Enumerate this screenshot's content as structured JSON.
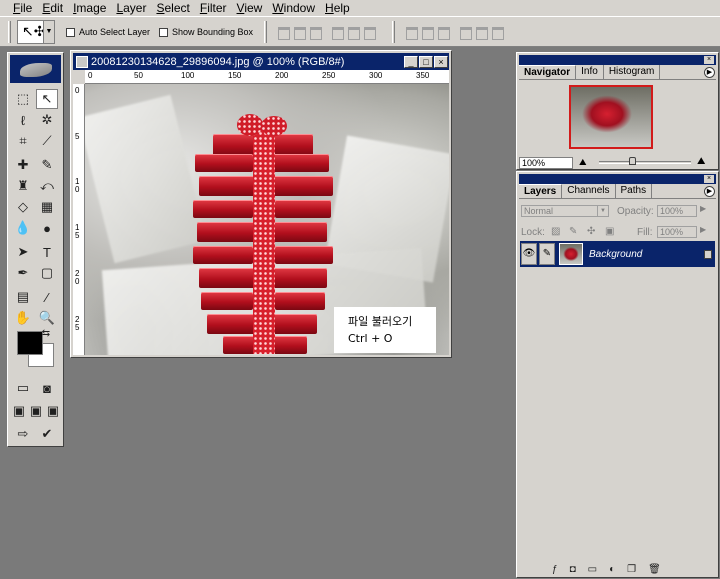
{
  "menu": [
    "File",
    "Edit",
    "Image",
    "Layer",
    "Select",
    "Filter",
    "View",
    "Window",
    "Help"
  ],
  "options": {
    "auto_select_label": "Auto Select Layer",
    "show_bounding_label": "Show Bounding Box"
  },
  "document": {
    "title": "20081230134628_29896094.jpg @ 100% (RGB/8#)",
    "ruler_top": [
      "0",
      "50",
      "100",
      "150",
      "200",
      "250",
      "300",
      "350"
    ],
    "ruler_left": [
      "0",
      "5",
      "1 0",
      "1 5",
      "2 0",
      "2 5"
    ],
    "note_line1": "파일 불러오기",
    "note_line2": "Ctrl + O"
  },
  "navigator": {
    "tabs": [
      "Navigator",
      "Info",
      "Histogram"
    ],
    "zoom": "100%"
  },
  "layers": {
    "tabs": [
      "Layers",
      "Channels",
      "Paths"
    ],
    "blend_mode": "Normal",
    "opacity_label": "Opacity:",
    "opacity_value": "100%",
    "lock_label": "Lock:",
    "fill_label": "Fill:",
    "fill_value": "100%",
    "layer_name": "Background"
  },
  "colors": {
    "title_bar": "#0a246a",
    "chrome": "#d6d3ce",
    "workspace": "#7a7a7a",
    "gift": "#c8141f"
  }
}
